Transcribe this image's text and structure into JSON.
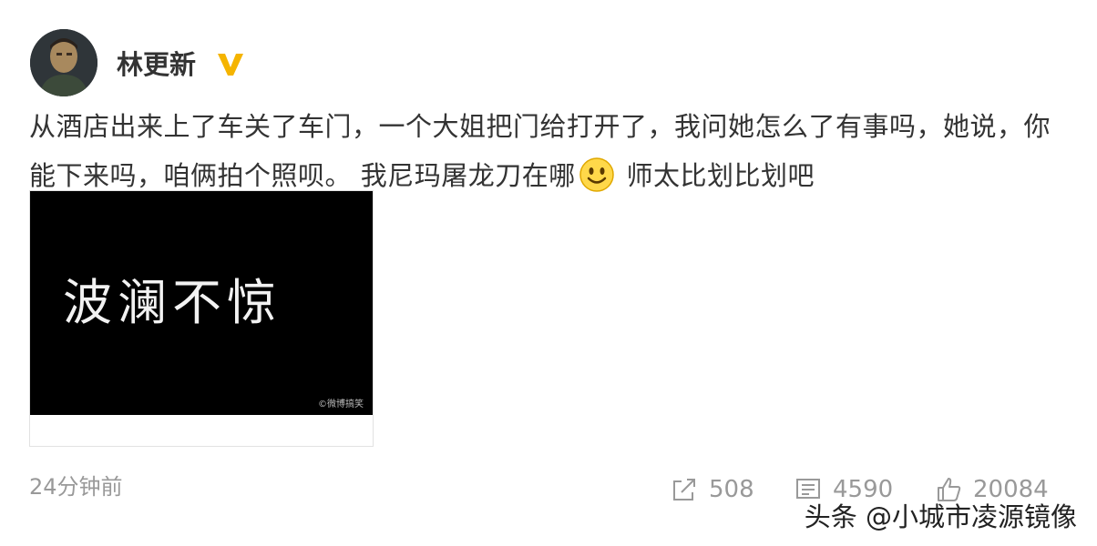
{
  "user": {
    "name": "林更新"
  },
  "post": {
    "text_part1": "从酒店出来上了车关了车门，一个大姐把门给打开了，我问她怎么了有事吗，她说，你能下来吗，咱俩拍个照呗。 我尼玛屠龙刀在哪",
    "text_part2": " 师太比划比划吧",
    "image_caption": "波澜不惊",
    "image_watermark": "©微博搞笑",
    "timestamp": "24分钟前"
  },
  "actions": {
    "share_count": "508",
    "comment_count": "4590",
    "like_count": "20084"
  },
  "watermark": "头条 @小城市凌源镜像",
  "icons": {
    "verified": "verified-v-icon",
    "emoji": "smile-emoji-icon",
    "share": "share-icon",
    "comment": "comment-icon",
    "like": "like-icon"
  },
  "colors": {
    "verified": "#f5b400",
    "text": "#333333",
    "muted": "#999999"
  }
}
